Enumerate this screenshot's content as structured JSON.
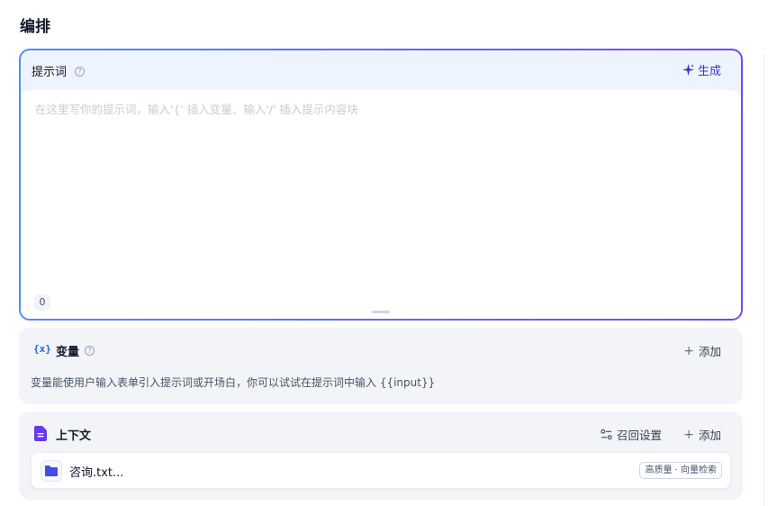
{
  "page": {
    "title": "编排"
  },
  "prompt": {
    "title": "提示词",
    "help_icon": "?",
    "generate_label": "生成",
    "placeholder": "在这里写你的提示词，输入'{' 插入变量、输入'/' 插入提示内容块",
    "char_count": "0"
  },
  "variables": {
    "icon_text": "{x}",
    "title": "变量",
    "add_label": "添加",
    "description": "变量能使用户输入表单引入提示词或开场白，你可以试试在提示词中输入 {{input}}"
  },
  "context": {
    "title": "上下文",
    "recall_label": "召回设置",
    "add_label": "添加",
    "items": [
      {
        "name": "咨询.txt...",
        "badge": "高质量 · 向量检索"
      }
    ]
  },
  "colors": {
    "accent": "#3538cd",
    "border_gradient_start": "#4f8ef7",
    "border_gradient_end": "#6f4cf0",
    "card_bg": "#f2f4f7"
  },
  "icons": {
    "prompt_help": "help-circle-icon",
    "generate": "sparkle-icon",
    "variable": "variable-braces-icon",
    "context": "document-icon",
    "recall": "settings-sliders-icon",
    "dataset": "folder-icon",
    "add": "plus-icon"
  }
}
